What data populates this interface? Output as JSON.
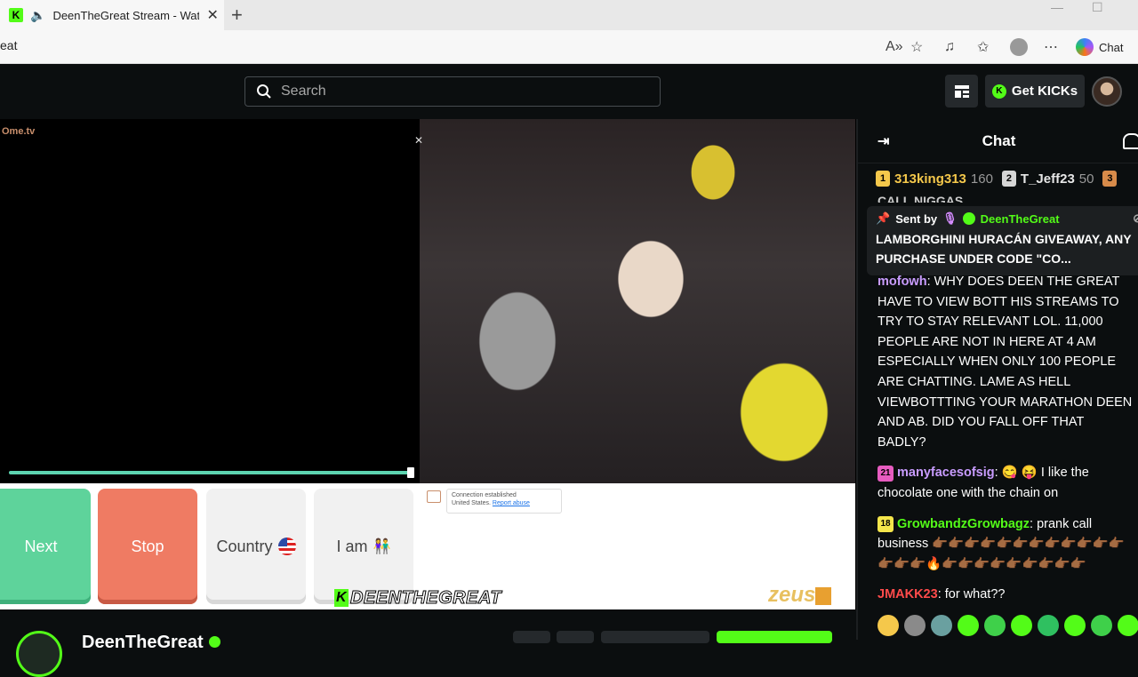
{
  "browser": {
    "tab_title": "DeenTheGreat Stream - Watch",
    "url_fragment": "eat",
    "chat_label": "Chat"
  },
  "header": {
    "search_placeholder": "Search",
    "get_kicks_label": "Get KICKs"
  },
  "video": {
    "left_logo": "Ome.tv",
    "buttons": {
      "next": "Next",
      "stop": "Stop",
      "country": "Country",
      "i_am": "I am"
    },
    "connection": {
      "status": "Connection established",
      "location": "United States.",
      "report": "Report abuse"
    },
    "sponsor": "zeus",
    "watermark": "DEENTHEGREAT"
  },
  "channel": {
    "name": "DeenTheGreat"
  },
  "chat": {
    "title": "Chat",
    "leaderboard": [
      {
        "rank": "1",
        "name": "313king313",
        "points": "160",
        "color": "#f5c84b"
      },
      {
        "rank": "2",
        "name": "T_Jeff23",
        "points": "50",
        "color": "#d6d6d6"
      },
      {
        "rank": "3",
        "name": "",
        "points": "",
        "color": "#d88b4a"
      }
    ],
    "ghost_line": "CALL NIGGAS",
    "pinned": {
      "sent_by": "Sent by",
      "user": "DeenTheGreat",
      "message": "LAMBORGHINI HURACÁN GIVEAWAY, ANY PURCHASE UNDER CODE \"CO..."
    },
    "messages": [
      {
        "user": "mofowh",
        "color": "#c99cff",
        "badge": "",
        "badge_color": "",
        "text": ": WHY DOES DEEN THE GREAT HAVE TO VIEW BOTT HIS STREAMS TO TRY TO STAY RELEVANT LOL. 11,000 PEOPLE ARE NOT IN HERE AT 4 AM ESPECIALLY WHEN ONLY 100 PEOPLE ARE CHATTING. LAME AS HELL VIEWBOTTTING YOUR MARATHON DEEN AND AB. DID YOU FALL OFF THAT BADLY?"
      },
      {
        "user": "manyfacesofsig",
        "color": "#c99cff",
        "badge": "21",
        "badge_color": "#e75cc0",
        "text": ": 😋 😝 I like the chocolate one with the chain on"
      },
      {
        "user": "GrowbandzGrowbagz",
        "color": "#53fc18",
        "badge": "18",
        "badge_color": "#f5e64b",
        "text": ": prank call business 👉🏾👉🏾👉🏾👉🏾👉🏾👉🏾👉🏾👉🏾👉🏾👉🏾👉🏾👉🏾👉🏾👉🏾👉🏾🔥👉🏾👉🏾👉🏾👉🏾👉🏾👉🏾👉🏾👉🏾👉🏾"
      },
      {
        "user": "JMAKK23",
        "color": "#ff4b4b",
        "badge": "",
        "badge_color": "",
        "text": ": for what??"
      }
    ]
  }
}
